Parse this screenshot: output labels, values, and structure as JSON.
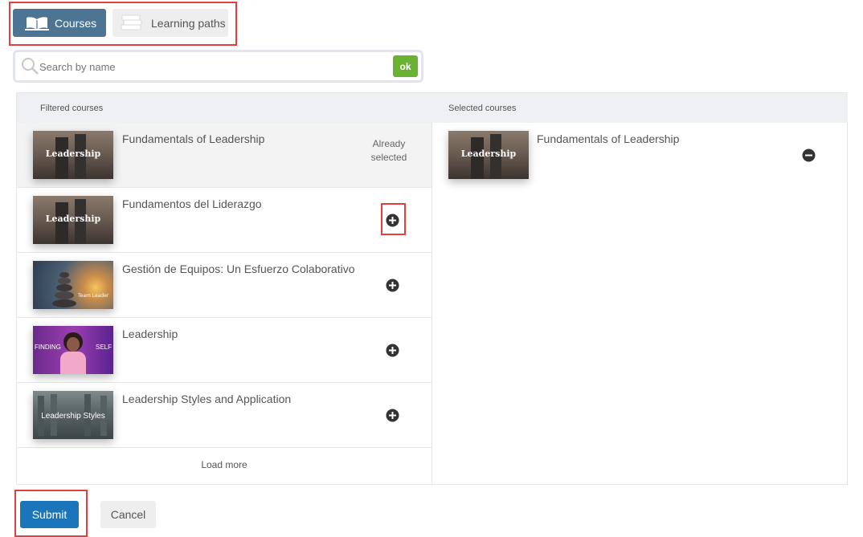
{
  "tabs": [
    {
      "label": "Courses",
      "active": true,
      "icon": "open-book-icon"
    },
    {
      "label": "Learning paths",
      "active": false,
      "icon": "stacked-books-icon"
    }
  ],
  "search": {
    "placeholder": "Search by name",
    "value": "",
    "ok_label": "ok"
  },
  "filtered": {
    "header": "Filtered courses",
    "rows": [
      {
        "title": "Fundamentals of Leadership",
        "thumb_text": "Leadership",
        "status": "Already selected",
        "status_line1": "Already",
        "status_line2": "selected"
      },
      {
        "title": "Fundamentos del Liderazgo",
        "thumb_text": "Leadership",
        "action": "add"
      },
      {
        "title": "Gestión de Equipos: Un Esfuerzo Colaborativo",
        "thumb_text": "Team Leader",
        "action": "add"
      },
      {
        "title": "Leadership",
        "thumb_text_left": "FINDING",
        "thumb_text_right": "SELF",
        "action": "add"
      },
      {
        "title": "Leadership Styles and Application",
        "thumb_text": "Leadership Styles",
        "action": "add"
      }
    ],
    "load_more": "Load more"
  },
  "selected": {
    "header": "Selected courses",
    "rows": [
      {
        "title": "Fundamentals of Leadership",
        "thumb_text": "Leadership",
        "action": "remove"
      }
    ]
  },
  "actions": {
    "submit": "Submit",
    "cancel": "Cancel"
  },
  "colors": {
    "accent": "#4d7593",
    "ok": "#6bb233",
    "submit": "#1b75bb",
    "highlight": "#e04040"
  }
}
